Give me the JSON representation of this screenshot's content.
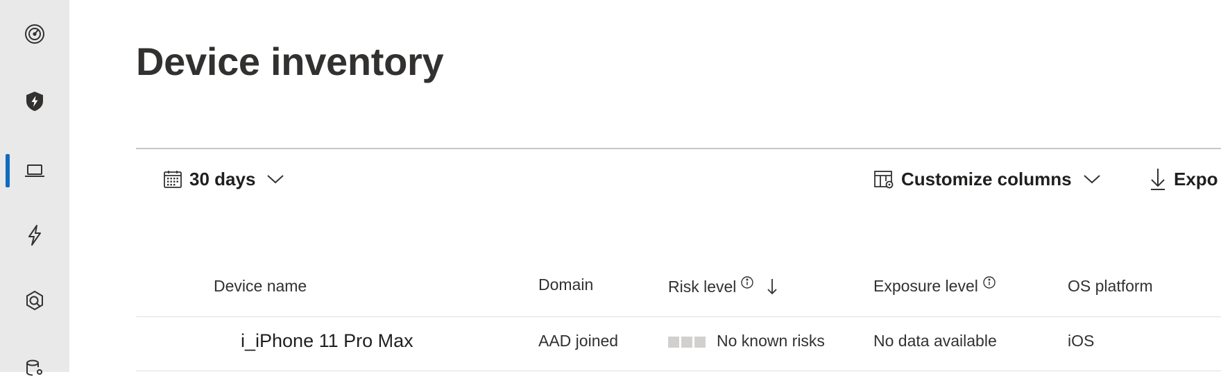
{
  "sidebar": {
    "items": [
      {
        "icon": "gauge-icon",
        "active": false
      },
      {
        "icon": "shield-bolt-icon",
        "active": false
      },
      {
        "icon": "laptop-icon",
        "active": true
      },
      {
        "icon": "lightning-icon",
        "active": false
      },
      {
        "icon": "hunting-icon",
        "active": false
      },
      {
        "icon": "database-user-icon",
        "active": false
      }
    ],
    "accent_color": "#0f6cbd"
  },
  "page": {
    "title": "Device inventory"
  },
  "toolbar": {
    "date_range_label": "30 days",
    "customize_columns_label": "Customize columns",
    "export_label": "Expo"
  },
  "table": {
    "columns": [
      {
        "label": "Device name"
      },
      {
        "label": "Domain"
      },
      {
        "label": "Risk level",
        "info": true,
        "sorted": "descending"
      },
      {
        "label": "Exposure level",
        "info": true
      },
      {
        "label": "OS platform"
      }
    ],
    "rows": [
      {
        "device_name": "i_iPhone 11 Pro Max",
        "domain": "AAD joined",
        "risk_level": "No known risks",
        "exposure_level": "No data available",
        "os_platform": "iOS"
      }
    ]
  }
}
